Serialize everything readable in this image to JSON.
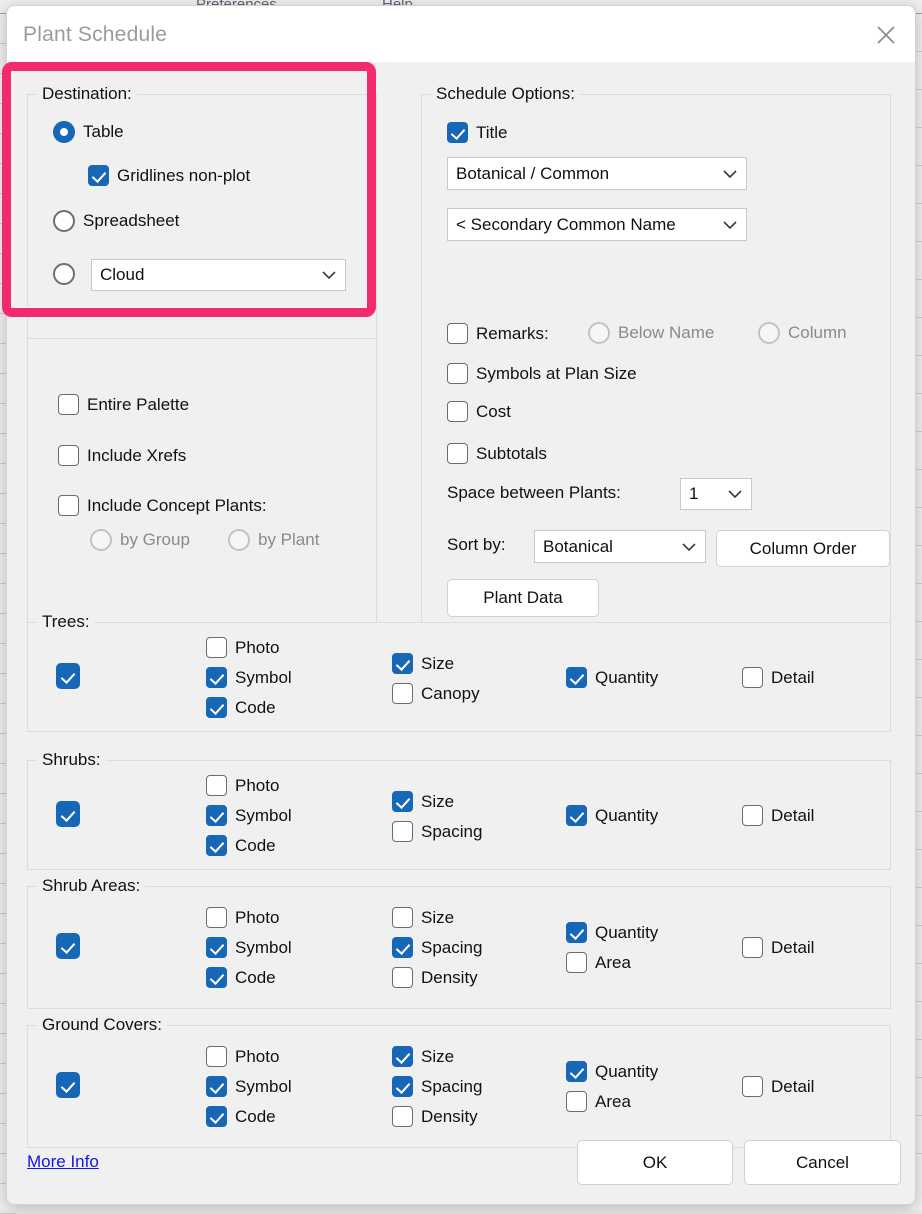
{
  "background": {
    "menu_preferences": "Preferences",
    "menu_help": "Help"
  },
  "dialog": {
    "title": "Plant Schedule",
    "close_icon": "close-icon"
  },
  "destination": {
    "legend": "Destination:",
    "table": {
      "label": "Table",
      "checked": true
    },
    "gridlines": {
      "label": "Gridlines non-plot",
      "checked": true
    },
    "spreadsheet": {
      "label": "Spreadsheet",
      "checked": false
    },
    "cloud": {
      "selected": false,
      "value": "Cloud"
    }
  },
  "scope": {
    "entire_palette": {
      "label": "Entire Palette",
      "checked": false
    },
    "include_xrefs": {
      "label": "Include Xrefs",
      "checked": false
    },
    "include_concept": {
      "label": "Include Concept Plants:",
      "checked": false
    },
    "by_group": {
      "label": "by Group",
      "checked": false,
      "enabled": false
    },
    "by_plant": {
      "label": "by Plant",
      "checked": false,
      "enabled": false
    }
  },
  "schedule_options": {
    "legend": "Schedule Options:",
    "title_cb": {
      "label": "Title",
      "checked": true
    },
    "name_format": "Botanical / Common",
    "secondary_name": "< Secondary Common Name",
    "remarks": {
      "label": "Remarks:",
      "checked": false
    },
    "remarks_below_name": {
      "label": "Below Name",
      "checked": false,
      "enabled": false
    },
    "remarks_column": {
      "label": "Column",
      "checked": false,
      "enabled": false
    },
    "symbols_plan_size": {
      "label": "Symbols at Plan Size",
      "checked": false
    },
    "cost": {
      "label": "Cost",
      "checked": false
    },
    "subtotals": {
      "label": "Subtotals",
      "checked": false
    },
    "space_between_label": "Space between Plants:",
    "space_between_value": "1",
    "sort_by_label": "Sort by:",
    "sort_by_value": "Botanical",
    "column_order_button": "Column Order",
    "plant_data_button": "Plant Data"
  },
  "categories": [
    {
      "legend": "Trees:",
      "enabled": true,
      "col1": [
        {
          "label": "Photo",
          "checked": false
        },
        {
          "label": "Symbol",
          "checked": true
        },
        {
          "label": "Code",
          "checked": true
        }
      ],
      "col2": [
        {
          "label": "Size",
          "checked": true
        },
        {
          "label": "Canopy",
          "checked": false
        }
      ],
      "col3": [
        {
          "label": "Quantity",
          "checked": true
        }
      ],
      "col4": [
        {
          "label": "Detail",
          "checked": false
        }
      ]
    },
    {
      "legend": "Shrubs:",
      "enabled": true,
      "col1": [
        {
          "label": "Photo",
          "checked": false
        },
        {
          "label": "Symbol",
          "checked": true
        },
        {
          "label": "Code",
          "checked": true
        }
      ],
      "col2": [
        {
          "label": "Size",
          "checked": true
        },
        {
          "label": "Spacing",
          "checked": false
        }
      ],
      "col3": [
        {
          "label": "Quantity",
          "checked": true
        }
      ],
      "col4": [
        {
          "label": "Detail",
          "checked": false
        }
      ]
    },
    {
      "legend": "Shrub Areas:",
      "enabled": true,
      "col1": [
        {
          "label": "Photo",
          "checked": false
        },
        {
          "label": "Symbol",
          "checked": true
        },
        {
          "label": "Code",
          "checked": true
        }
      ],
      "col2": [
        {
          "label": "Size",
          "checked": false
        },
        {
          "label": "Spacing",
          "checked": true
        },
        {
          "label": "Density",
          "checked": false
        }
      ],
      "col3": [
        {
          "label": "Quantity",
          "checked": true
        },
        {
          "label": "Area",
          "checked": false
        }
      ],
      "col4": [
        {
          "label": "Detail",
          "checked": false
        }
      ]
    },
    {
      "legend": "Ground Covers:",
      "enabled": true,
      "col1": [
        {
          "label": "Photo",
          "checked": false
        },
        {
          "label": "Symbol",
          "checked": true
        },
        {
          "label": "Code",
          "checked": true
        }
      ],
      "col2": [
        {
          "label": "Size",
          "checked": true
        },
        {
          "label": "Spacing",
          "checked": true
        },
        {
          "label": "Density",
          "checked": false
        }
      ],
      "col3": [
        {
          "label": "Quantity",
          "checked": true
        },
        {
          "label": "Area",
          "checked": false
        }
      ],
      "col4": [
        {
          "label": "Detail",
          "checked": false
        }
      ]
    }
  ],
  "footer": {
    "more_info": "More Info",
    "ok": "OK",
    "cancel": "Cancel"
  },
  "colors": {
    "accent_blue": "#1767b7",
    "highlight_pink": "#f42a6e",
    "dialog_bg": "#f0f0f0",
    "link_blue": "#1414e8"
  }
}
